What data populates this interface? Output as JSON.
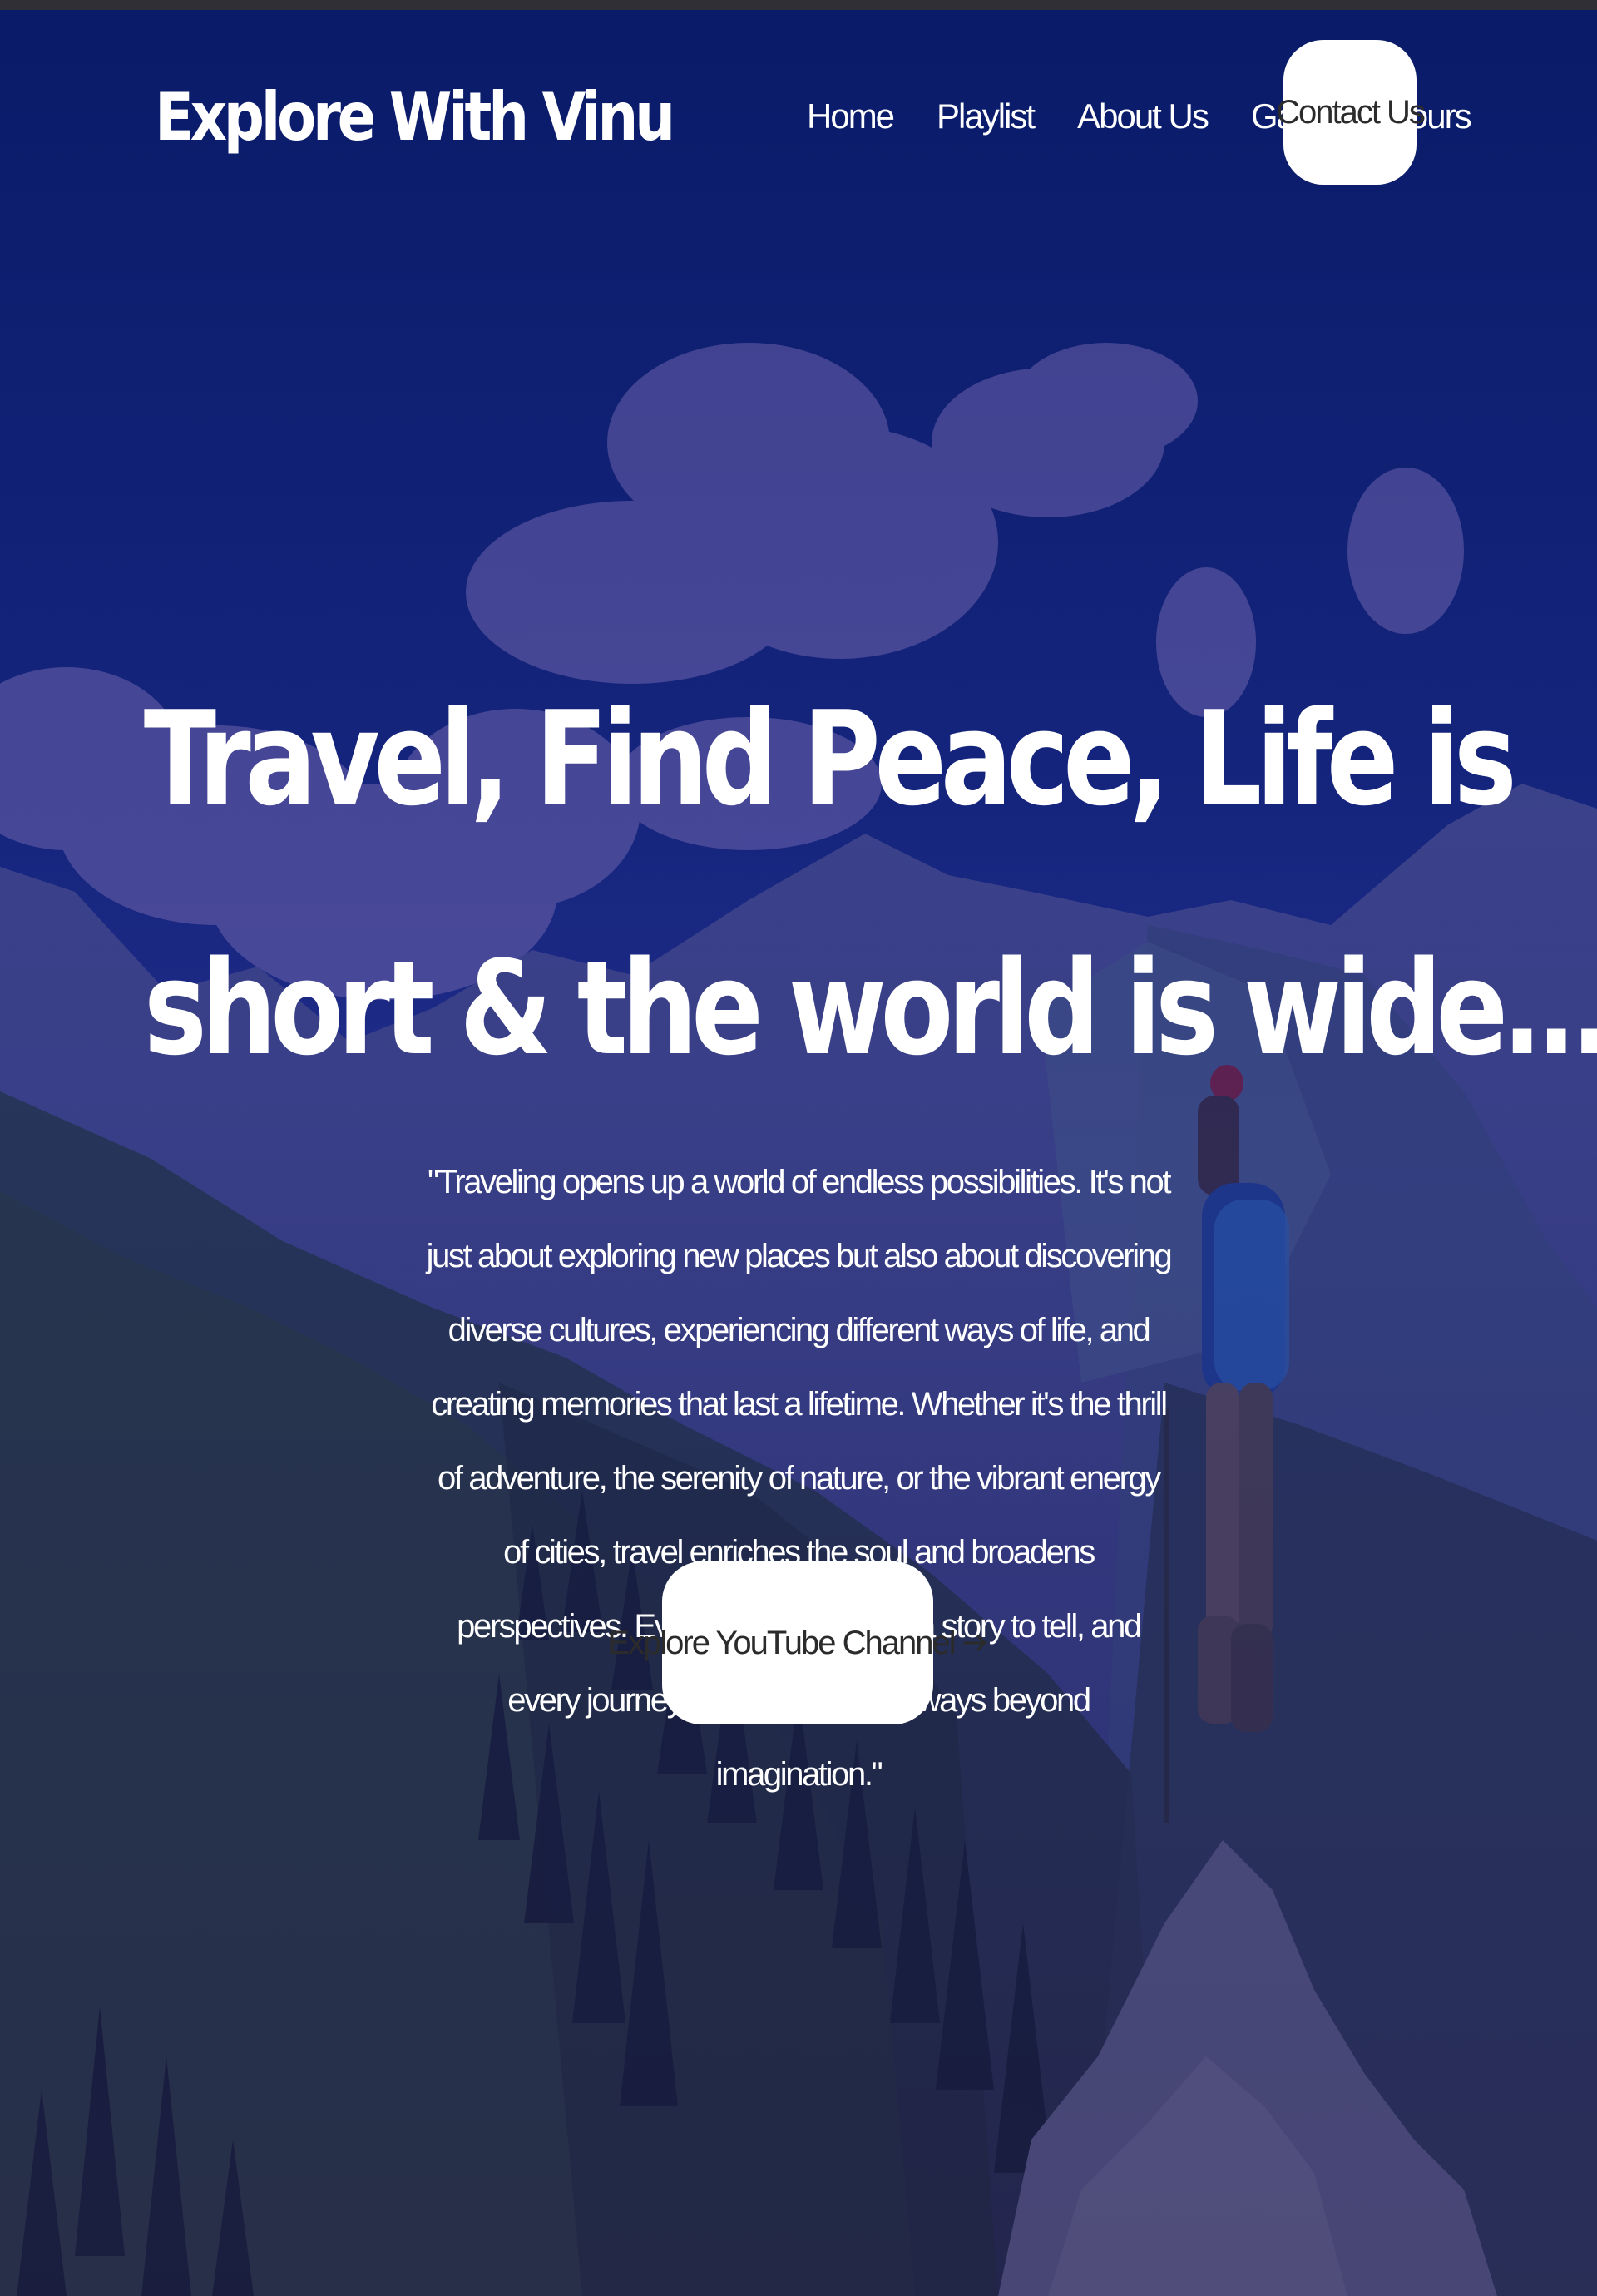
{
  "header": {
    "brand": "Explore With Vinu",
    "nav": [
      {
        "label": "Home"
      },
      {
        "label": "Playlist"
      },
      {
        "label": "About Us"
      },
      {
        "label": "Gallery"
      },
      {
        "label": "Tours"
      }
    ],
    "contact_label": "Contact Us"
  },
  "hero": {
    "headline_line1": "Travel, Find Peace, Life is",
    "headline_line2": "short & the world is wide...",
    "quote": "\"Traveling opens up a world of endless possibilities. It's not just about exploring new places but also about discovering diverse cultures, experiencing different ways of life, and creating memories that last a lifetime. Whether it's the thrill of adventure, the serenity of nature, or the vibrant energy of cities, travel enriches the soul and broadens perspectives. Every destination has a story to tell, and every journey transforms you in ways beyond imagination.\"",
    "cta_label": "Explore YouTube Channel",
    "cta_icon": "arrow-right-icon"
  },
  "colors": {
    "overlay": "#0a1a6e",
    "button_bg": "#ffffff",
    "button_text": "#2b2b2b",
    "text": "#ffffff"
  }
}
